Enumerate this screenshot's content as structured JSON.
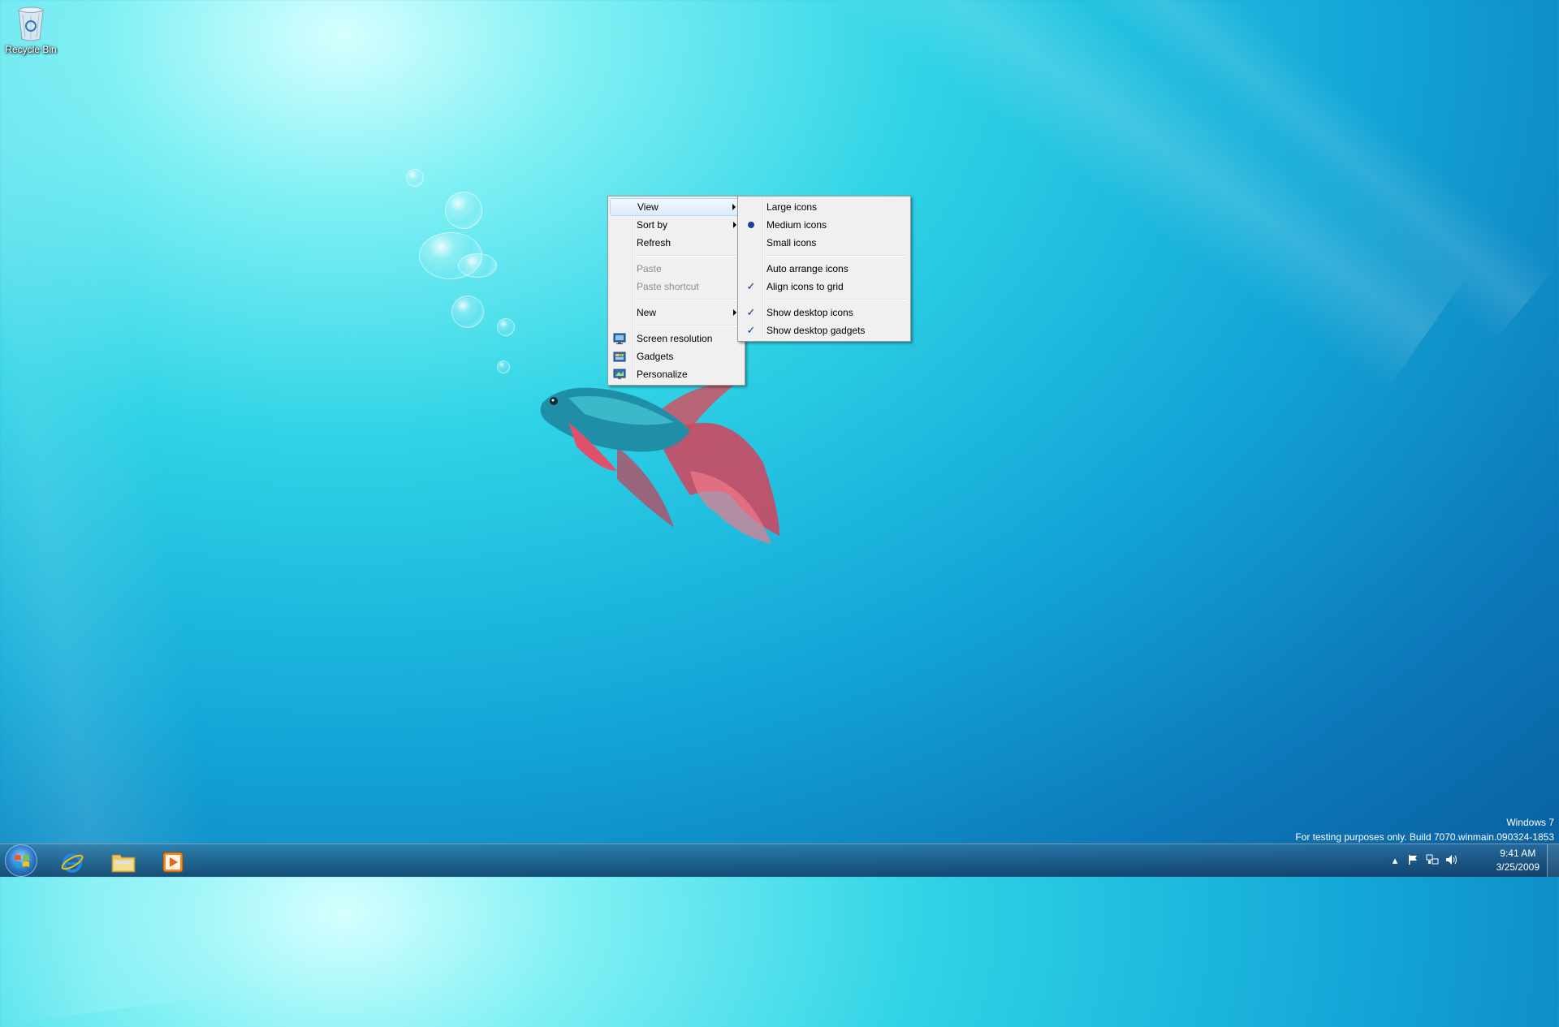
{
  "desktop": {
    "icons": [
      {
        "label": "Recycle Bin",
        "icon": "recycle-bin-icon"
      }
    ],
    "watermark": {
      "line1": "Windows 7",
      "line2": "For testing purposes only. Build 7070.winmain.090324-1853"
    }
  },
  "context_menu": {
    "items": [
      {
        "label": "View",
        "submenu": true,
        "highlighted": true
      },
      {
        "label": "Sort by",
        "submenu": true
      },
      {
        "label": "Refresh"
      },
      {
        "label": "Paste",
        "disabled": true
      },
      {
        "label": "Paste shortcut",
        "disabled": true
      },
      {
        "label": "New",
        "submenu": true
      },
      {
        "label": "Screen resolution",
        "icon": "monitor-icon"
      },
      {
        "label": "Gadgets",
        "icon": "gadgets-icon"
      },
      {
        "label": "Personalize",
        "icon": "personalize-icon"
      }
    ]
  },
  "view_submenu": {
    "items": [
      {
        "label": "Large icons"
      },
      {
        "label": "Medium icons",
        "selected": "radio"
      },
      {
        "label": "Small icons"
      },
      {
        "label": "Auto arrange icons"
      },
      {
        "label": "Align icons to grid",
        "selected": "check"
      },
      {
        "label": "Show desktop icons",
        "selected": "check"
      },
      {
        "label": "Show desktop gadgets",
        "selected": "check"
      }
    ],
    "check_glyph": "✓"
  },
  "taskbar": {
    "pinned": [
      {
        "name": "internet-explorer",
        "icon": "internet-explorer-icon"
      },
      {
        "name": "windows-explorer",
        "icon": "folder-icon"
      },
      {
        "name": "media-player",
        "icon": "media-player-icon"
      }
    ],
    "tray": {
      "up_arrow": "▴",
      "clock_time": "9:41 AM",
      "clock_date": "3/25/2009"
    }
  }
}
